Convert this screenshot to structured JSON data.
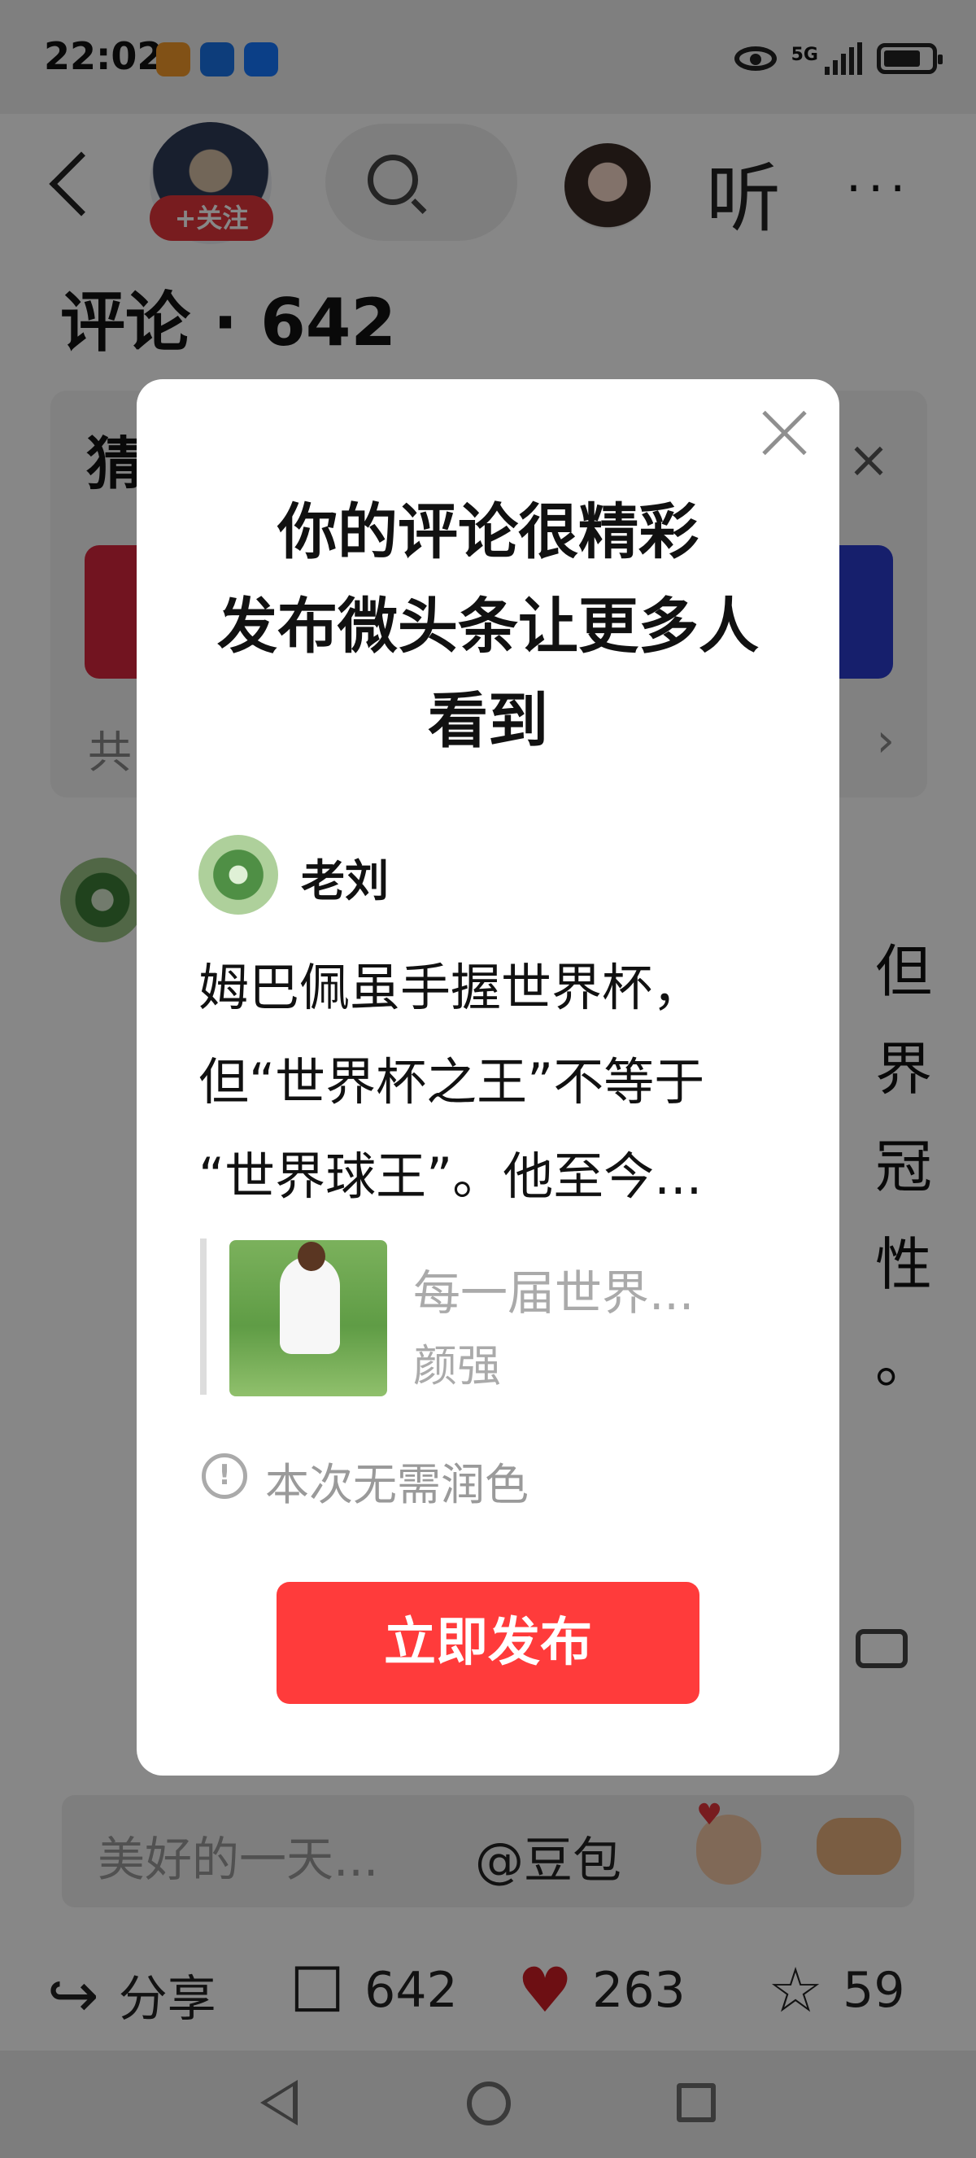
{
  "status_bar": {
    "time": "22:02",
    "network": "5G"
  },
  "header": {
    "follow_label": "+关注",
    "listen_label": "听",
    "more_label": "···"
  },
  "comments": {
    "title": "评论 · 642"
  },
  "guess_card": {
    "title": "猜",
    "footer_left": "共",
    "footer_right": "›"
  },
  "background_comment": {
    "text": "但\n界\n冠\n性\n。"
  },
  "comment_input": {
    "placeholder": "美好的一天...",
    "mention": "@豆包"
  },
  "actions": {
    "share_label": "分享",
    "comment_count": "642",
    "like_count": "263",
    "favorite_count": "59"
  },
  "modal": {
    "title": "你的评论很精彩\n发布微头条让更多人\n看到",
    "user_name": "老刘",
    "comment_text": "姆巴佩虽手握世界杯，\n但“世界杯之王”不等于\n“世界球王”。他至今...",
    "article_title": "每一届世界...",
    "article_author": "颜强",
    "notice": "本次无需润色",
    "publish_button": "立即发布"
  },
  "colors": {
    "accent": "#ff3b3b",
    "follow_red": "#e2363b",
    "like_red": "#cf1e24"
  }
}
